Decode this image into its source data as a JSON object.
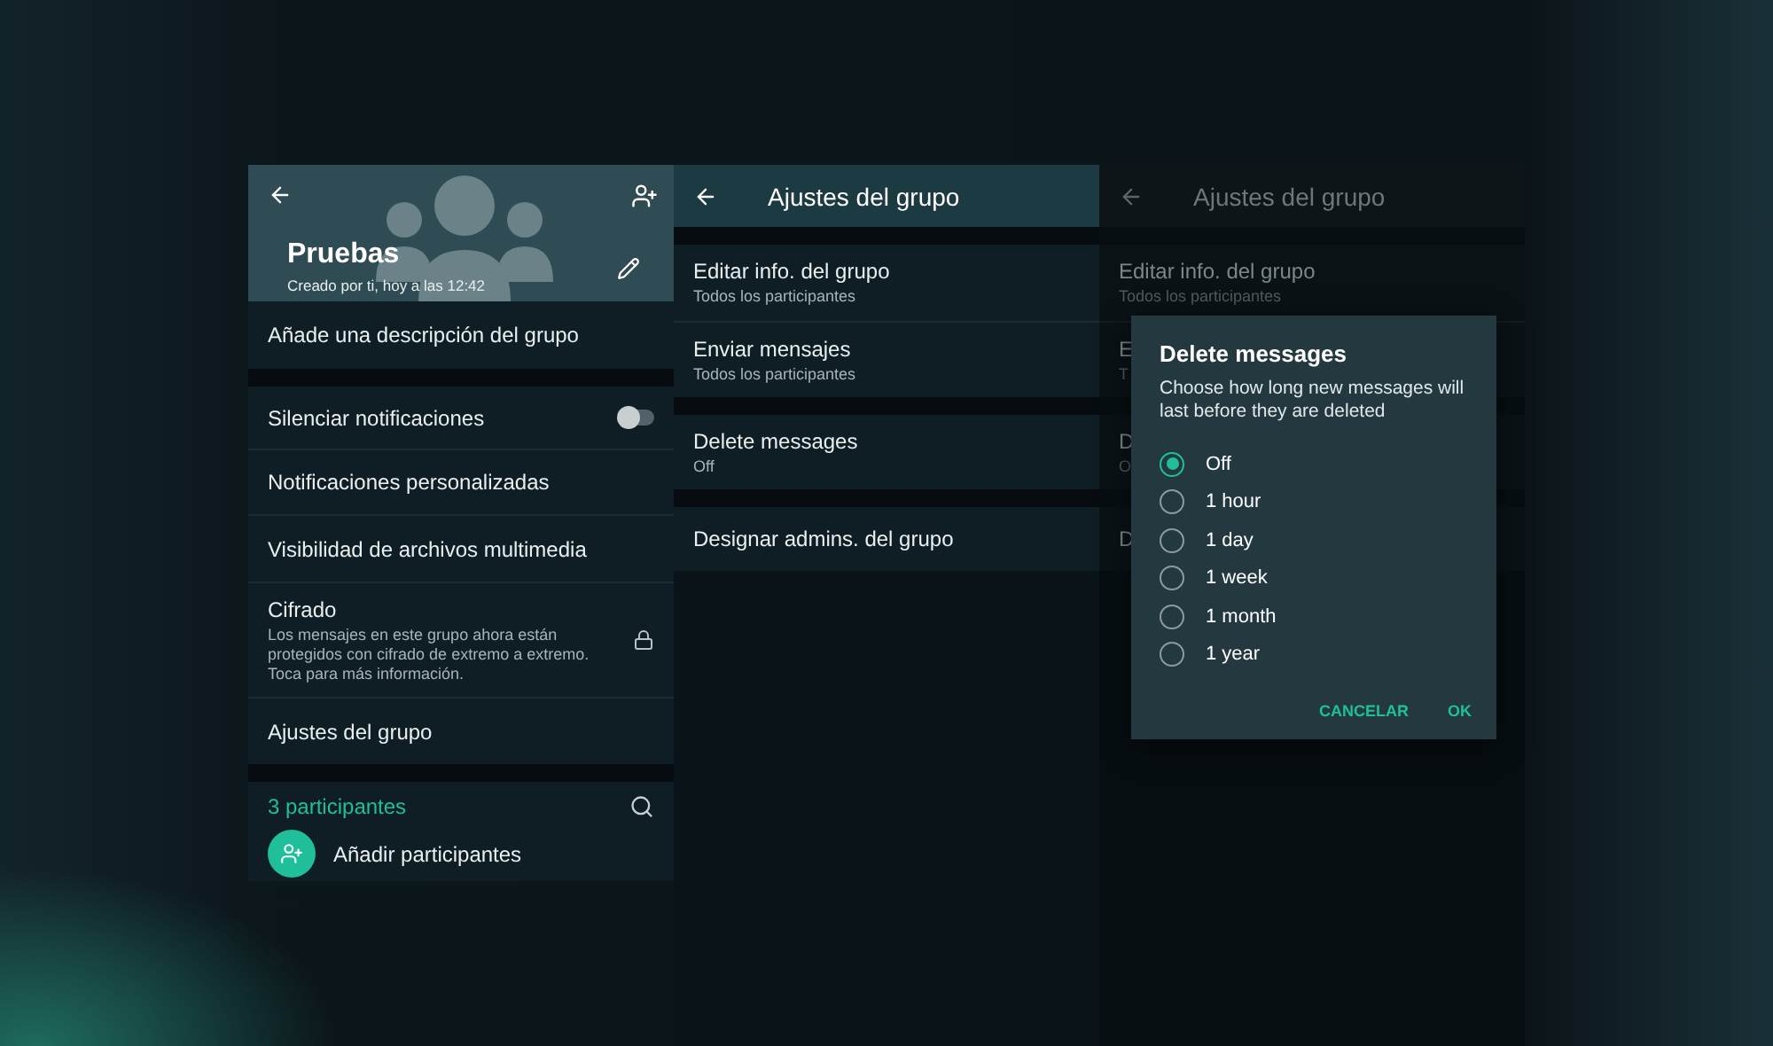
{
  "group_info": {
    "name": "Pruebas",
    "subtitle": "Creado por ti, hoy a las 12:42",
    "description_prompt": "Añade una descripción del grupo",
    "items": [
      {
        "kind": "toggle",
        "label": "Silenciar notificaciones",
        "on": false
      },
      {
        "kind": "plain",
        "label": "Notificaciones personalizadas"
      },
      {
        "kind": "plain",
        "label": "Visibilidad de archivos multimedia"
      },
      {
        "kind": "info",
        "label": "Cifrado",
        "detail": "Los mensajes en este grupo ahora están protegidos con cifrado de extremo a extremo. Toca para más información."
      },
      {
        "kind": "plain",
        "label": "Ajustes del grupo"
      }
    ],
    "participants_count": "3 participantes",
    "add_participants": "Añadir participantes"
  },
  "group_settings": {
    "title": "Ajustes del grupo",
    "sections": [
      [
        {
          "title": "Editar info. del grupo",
          "subtitle": "Todos los participantes"
        },
        {
          "title": "Enviar mensajes",
          "subtitle": "Todos los participantes"
        }
      ],
      [
        {
          "title": "Delete messages",
          "subtitle": "Off"
        }
      ],
      [
        {
          "title": "Designar admins. del grupo"
        }
      ]
    ]
  },
  "dimmed_settings": {
    "title": "Ajustes del grupo",
    "sections": [
      [
        {
          "title": "Editar info. del grupo",
          "subtitle": "Todos los participantes"
        },
        {
          "title": "E",
          "subtitle": "T"
        }
      ],
      [
        {
          "title": "D",
          "subtitle": "O"
        }
      ],
      [
        {
          "title": "D"
        }
      ]
    ]
  },
  "dialog": {
    "title": "Delete messages",
    "message": "Choose how long new messages will last before they are deleted",
    "options": [
      {
        "label": "Off",
        "selected": true
      },
      {
        "label": "1 hour",
        "selected": false
      },
      {
        "label": "1 day",
        "selected": false
      },
      {
        "label": "1 week",
        "selected": false
      },
      {
        "label": "1 month",
        "selected": false
      },
      {
        "label": "1 year",
        "selected": false
      }
    ],
    "buttons": [
      "CANCELAR",
      "OK"
    ]
  }
}
